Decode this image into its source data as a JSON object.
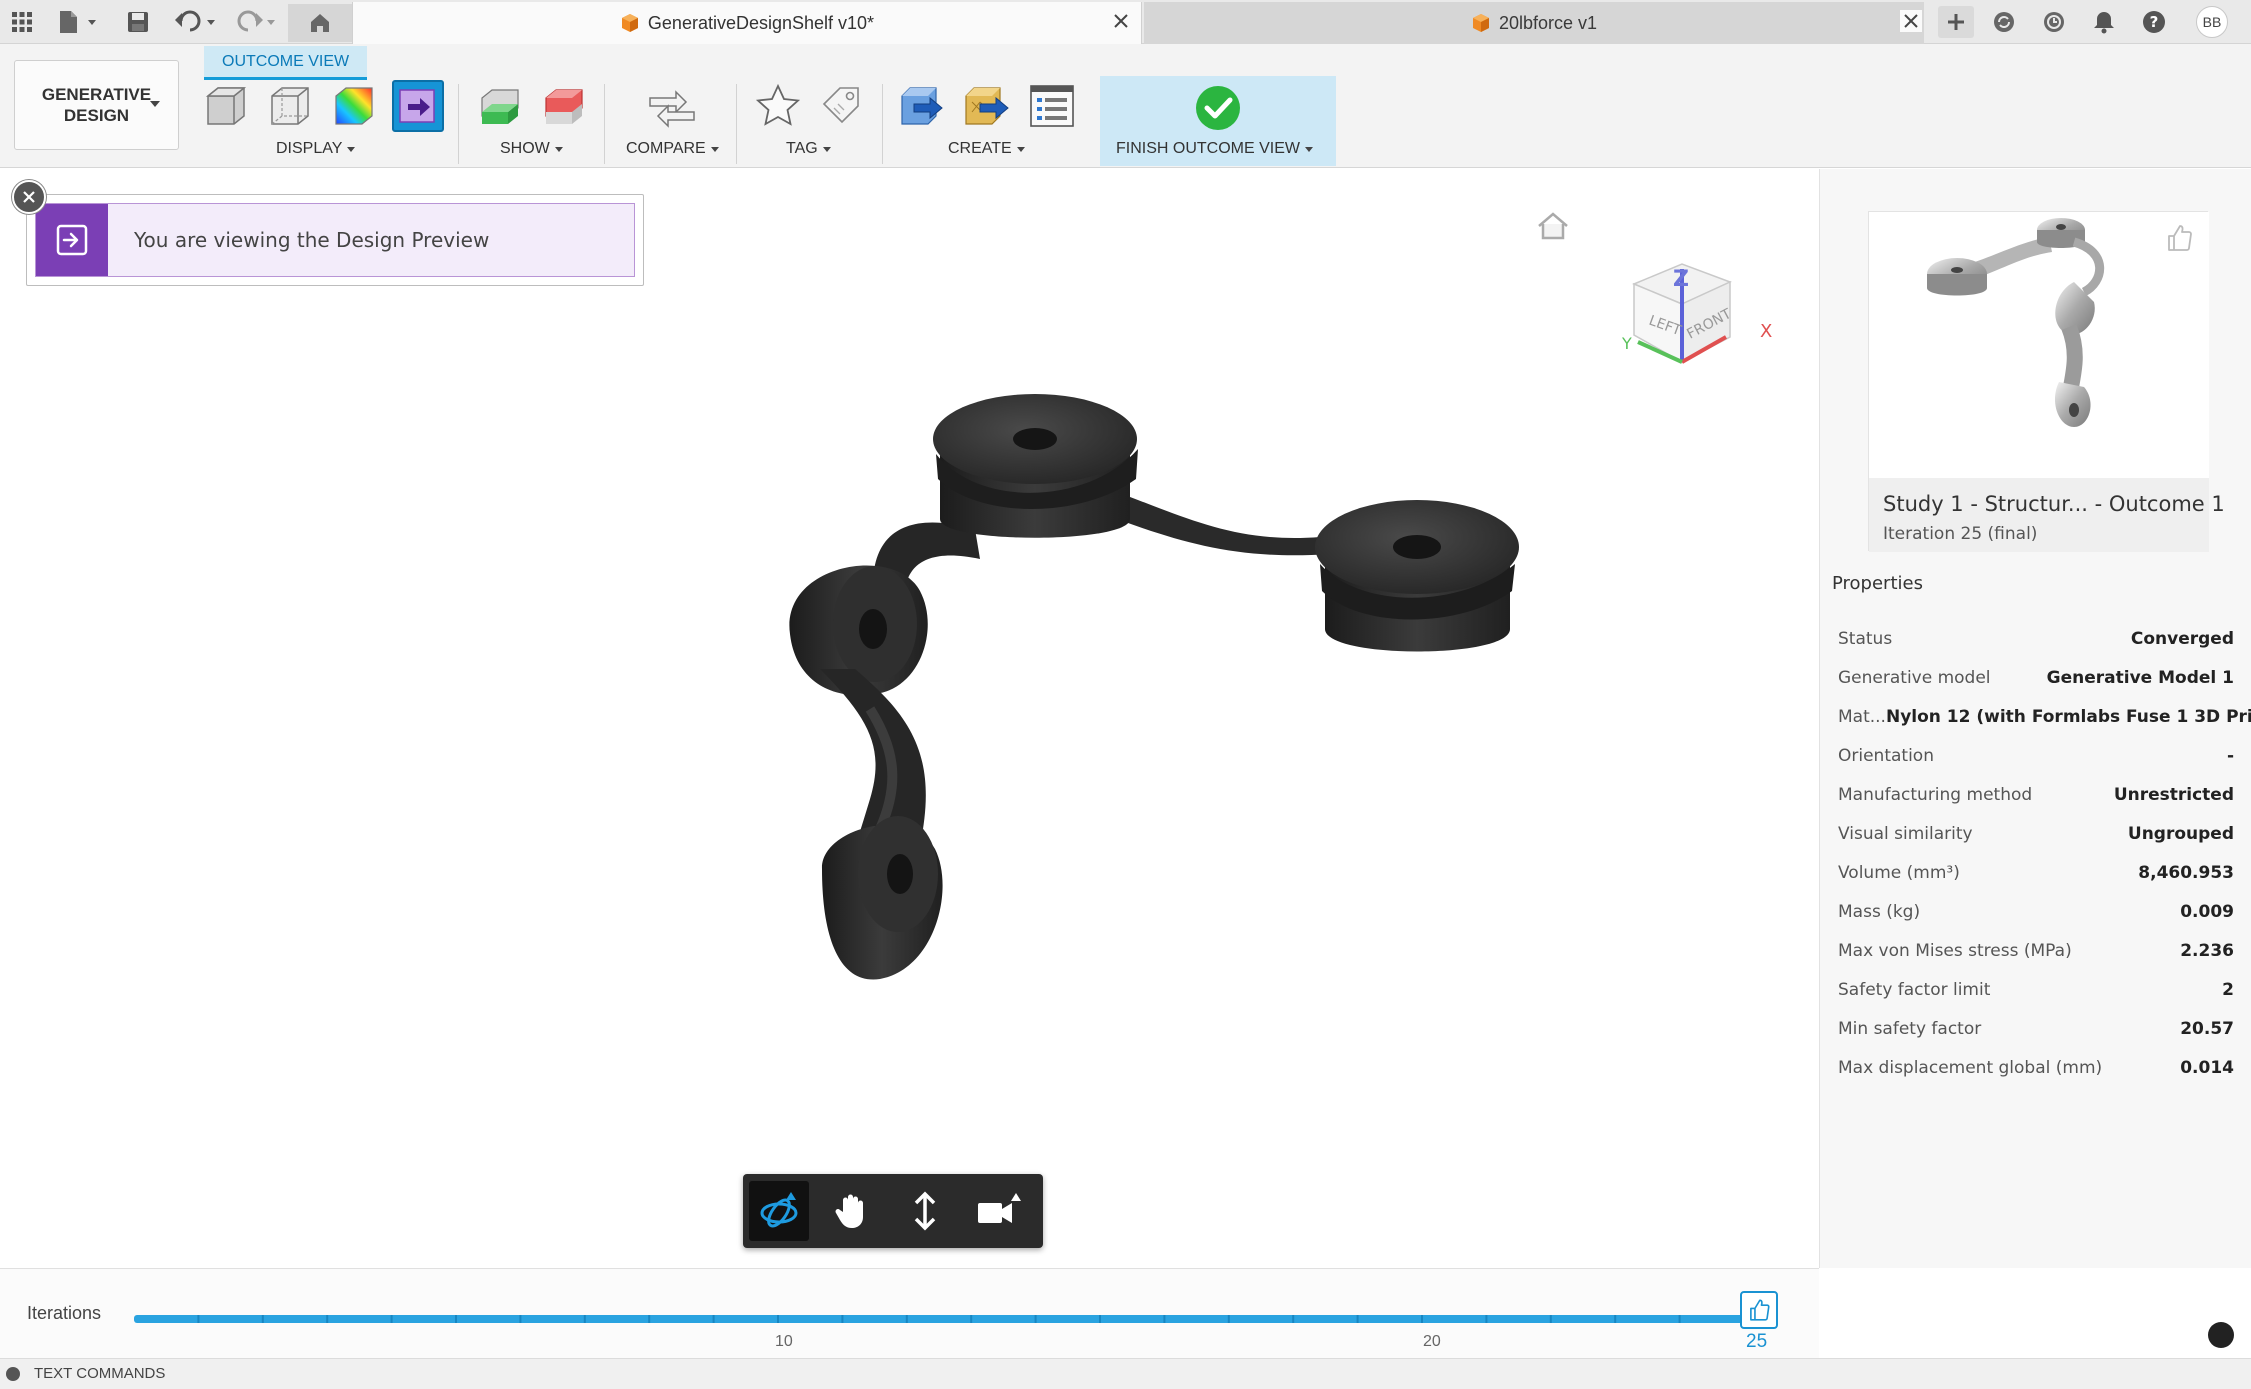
{
  "titlebar": {
    "tabs": [
      {
        "label": "GenerativeDesignShelf v10*",
        "active": true
      },
      {
        "label": "20lbforce v1",
        "active": false
      }
    ],
    "user_initials": "BB"
  },
  "ribbon": {
    "workspace_label": "GENERATIVE\nDESIGN",
    "context_tab": "OUTCOME VIEW",
    "groups": {
      "display": "DISPLAY",
      "show": "SHOW",
      "compare": "COMPARE",
      "tag": "TAG",
      "create": "CREATE",
      "finish": "FINISH OUTCOME VIEW"
    }
  },
  "banner": {
    "text": "You are viewing the Design Preview"
  },
  "viewcube": {
    "top": "Z",
    "left": "LEFT",
    "front": "FRONT",
    "x_axis": "X",
    "y_axis": "Y"
  },
  "outcome": {
    "title": "Study 1 - Structur... - Outcome 1",
    "subtitle": "Iteration 25 (final)"
  },
  "properties": {
    "heading": "Properties",
    "rows": [
      {
        "label": "Status",
        "value": "Converged"
      },
      {
        "label": "Generative model",
        "value": "Generative Model 1"
      },
      {
        "label": "Mat...",
        "value": "Nylon 12 (with Formlabs Fuse 1 3D Pri..."
      },
      {
        "label": "Orientation",
        "value": "-"
      },
      {
        "label": "Manufacturing method",
        "value": "Unrestricted"
      },
      {
        "label": "Visual similarity",
        "value": "Ungrouped"
      },
      {
        "label": "Volume (mm³)",
        "value": "8,460.953"
      },
      {
        "label": "Mass (kg)",
        "value": "0.009"
      },
      {
        "label": "Max von Mises stress (MPa)",
        "value": "2.236"
      },
      {
        "label": "Safety factor limit",
        "value": "2"
      },
      {
        "label": "Min safety factor",
        "value": "20.57"
      },
      {
        "label": "Max displacement global (mm)",
        "value": "0.014"
      }
    ]
  },
  "timeline": {
    "label": "Iterations",
    "ticks": [
      "10",
      "20"
    ],
    "current": "25",
    "current_iteration": 25,
    "total_iterations": 25
  },
  "statusbar": {
    "text": "TEXT COMMANDS"
  },
  "colors": {
    "accent": "#1694d6",
    "banner_purple": "#7b3fb5",
    "finish_bg": "#cde8f6",
    "success_green": "#2bb540",
    "model": "#2a2a2a"
  }
}
